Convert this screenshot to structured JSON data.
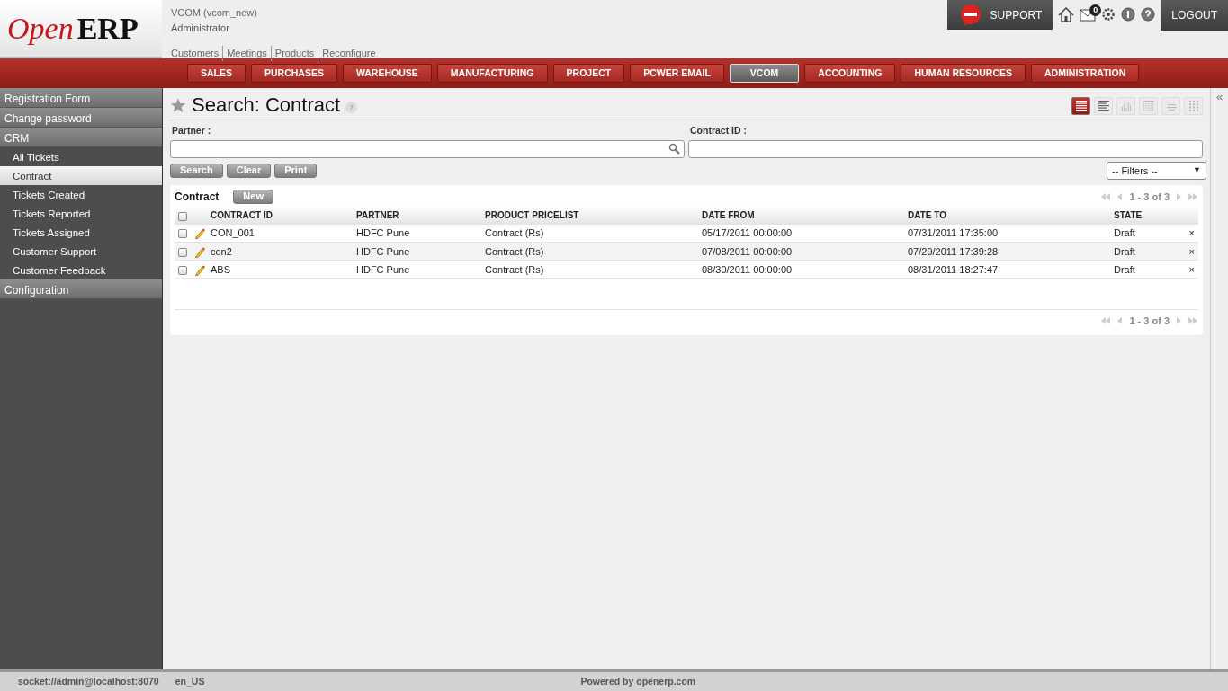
{
  "logo": {
    "part1": "Open",
    "part2": "ERP"
  },
  "header": {
    "database": "VCOM (vcom_new)",
    "user": "Administrator",
    "shortcuts": [
      "Customers",
      "Meetings",
      "Products",
      "Reconfigure"
    ]
  },
  "top_bar": {
    "support": "SUPPORT",
    "message_count": "0",
    "logout": "LOGOUT"
  },
  "menu": [
    {
      "label": "SALES",
      "selected": false
    },
    {
      "label": "PURCHASES",
      "selected": false
    },
    {
      "label": "WAREHOUSE",
      "selected": false
    },
    {
      "label": "MANUFACTURING",
      "selected": false
    },
    {
      "label": "PROJECT",
      "selected": false
    },
    {
      "label": "PCWER EMAIL",
      "selected": false
    },
    {
      "label": "VCOM",
      "selected": true
    },
    {
      "label": "ACCOUNTING",
      "selected": false
    },
    {
      "label": "HUMAN RESOURCES",
      "selected": false
    },
    {
      "label": "ADMINISTRATION",
      "selected": false
    }
  ],
  "sidebar": {
    "collapse": "«",
    "sections": [
      {
        "label": "Registration Form"
      },
      {
        "label": "Change password"
      },
      {
        "label": "CRM",
        "children": [
          {
            "label": "All Tickets",
            "selected": false
          },
          {
            "label": "Contract",
            "selected": true
          },
          {
            "label": "Tickets Created",
            "selected": false
          },
          {
            "label": "Tickets Reported",
            "selected": false
          },
          {
            "label": "Tickets Assigned",
            "selected": false
          },
          {
            "label": "Customer Support",
            "selected": false
          },
          {
            "label": "Customer Feedback",
            "selected": false
          }
        ]
      },
      {
        "label": "Configuration"
      }
    ]
  },
  "page": {
    "title": "Search: Contract",
    "help": "?"
  },
  "view_modes": [
    {
      "kind": "list",
      "selected": true
    },
    {
      "kind": "form",
      "selected": false
    },
    {
      "kind": "graph",
      "selected": false
    },
    {
      "kind": "calendar",
      "selected": false
    },
    {
      "kind": "gantt",
      "selected": false
    },
    {
      "kind": "grid",
      "selected": false
    }
  ],
  "search_fields": [
    {
      "label": "Partner :",
      "kind": "lookup"
    },
    {
      "label": "Contract ID :",
      "kind": "text"
    }
  ],
  "search_buttons": [
    "Search",
    "Clear",
    "Print"
  ],
  "filters": {
    "value": "-- Filters --",
    "arrow": "▼"
  },
  "list": {
    "title": "Contract",
    "all_checked": false,
    "new_button": "New",
    "pager_top": "1 - 3 of 3",
    "pager_bottom": "1 - 3 of 3",
    "columns": [
      "CONTRACT ID",
      "PARTNER",
      "PRODUCT PRICELIST",
      "DATE FROM",
      "DATE TO",
      "STATE"
    ],
    "rows": [
      {
        "checked": false,
        "cells": [
          "CON_001",
          "HDFC Pune",
          "Contract (Rs)",
          "05/17/2011 00:00:00",
          "07/31/2011 17:35:00",
          "Draft"
        ],
        "delete": "×"
      },
      {
        "checked": false,
        "cells": [
          "con2",
          "HDFC Pune",
          "Contract (Rs)",
          "07/08/2011 00:00:00",
          "07/29/2011 17:39:28",
          "Draft"
        ],
        "delete": "×"
      },
      {
        "checked": false,
        "cells": [
          "ABS",
          "HDFC Pune",
          "Contract (Rs)",
          "08/30/2011 00:00:00",
          "08/31/2011 18:27:47",
          "Draft"
        ],
        "delete": "×"
      }
    ]
  },
  "footer": {
    "connection": "socket://admin@localhost:8070",
    "language": "en_US",
    "powered_by": "Powered by openerp.com"
  }
}
